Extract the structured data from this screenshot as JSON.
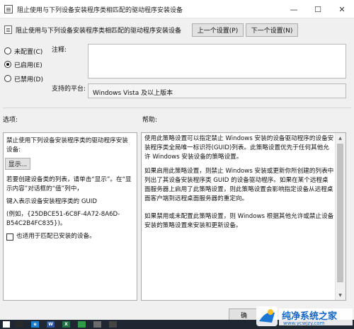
{
  "window": {
    "title": "阻止使用与下列设备安装程序类相匹配的驱动程序安装设备",
    "controls": {
      "minimize": "—",
      "maximize": "☐",
      "close": "✕"
    }
  },
  "header": {
    "setting_name": "阻止使用与下列设备安装程序类相匹配的驱动程序安装设备",
    "prev_button": "上一个设置(P)",
    "next_button": "下一个设置(N)"
  },
  "state": {
    "options": [
      {
        "label": "未配置(C)",
        "checked": false
      },
      {
        "label": "已启用(E)",
        "checked": true
      },
      {
        "label": "已禁用(D)",
        "checked": false
      }
    ]
  },
  "comment": {
    "label": "注释:",
    "value": ""
  },
  "supported": {
    "label": "支持的平台:",
    "value": "Windows Vista 及以上版本"
  },
  "options_pane": {
    "label": "选项:",
    "title": "禁止使用下列设备安装程序类的驱动程序安装设备:",
    "show_button": "显示...",
    "instruction": "若要创建设备类的列表，请单击“显示”。在“显示内容”对话框的“值”列中，",
    "guid_prompt": "键入表示设备安装程序类的 GUID",
    "example": "(例如，{25DBCE51-6C8F-4A72-8A6D-B54C2B4FC835})。",
    "checkbox_label": "也适用于匹配已安装的设备。"
  },
  "help_pane": {
    "label": "帮助:",
    "paragraphs": [
      "使用此策略设置可以指定禁止 Windows 安装的设备驱动程序的设备安装程序类全局唯一标识符(GUID)列表。此策略设置优先于任何其他允许 Windows 安装设备的策略设置。",
      "如果启用此策略设置，则禁止 Windows 安装或更新你所创建的列表中列出了其设备安装程序类 GUID 的设备驱动程序。如果在某个远程桌面服务器上启用了此策略设置，则此策略设置会影响指定设备从远程桌面客户端到远程桌面服务器的重定向。",
      "如果禁用或未配置此策略设置，则 Windows 根据其他允许或禁止设备安装的策略设置来安装和更新设备。"
    ]
  },
  "footer": {
    "ok_partial": "确"
  },
  "taskbar": {
    "items": [
      {
        "name": "app-icon",
        "text": "",
        "color": "#2a2a2a"
      },
      {
        "name": "ie-icon",
        "text": "e",
        "color": "#1d7fd0"
      },
      {
        "name": "word-icon",
        "text": "W",
        "color": "#2b579a"
      },
      {
        "name": "excel-icon",
        "text": "X",
        "color": "#217346"
      },
      {
        "name": "chat-icon",
        "text": "",
        "color": "#2f9b44"
      },
      {
        "name": "gear-icon",
        "text": "",
        "color": "#6b6b6b"
      },
      {
        "name": "cortana-icon",
        "text": "",
        "color": "#444"
      }
    ]
  },
  "watermark": {
    "brand": "纯净系统之家",
    "url": "www.ycwjzy.com",
    "colors": {
      "brand": "#1565c0",
      "logo_blue": "#1976d2",
      "logo_yellow": "#fbc02d"
    }
  }
}
